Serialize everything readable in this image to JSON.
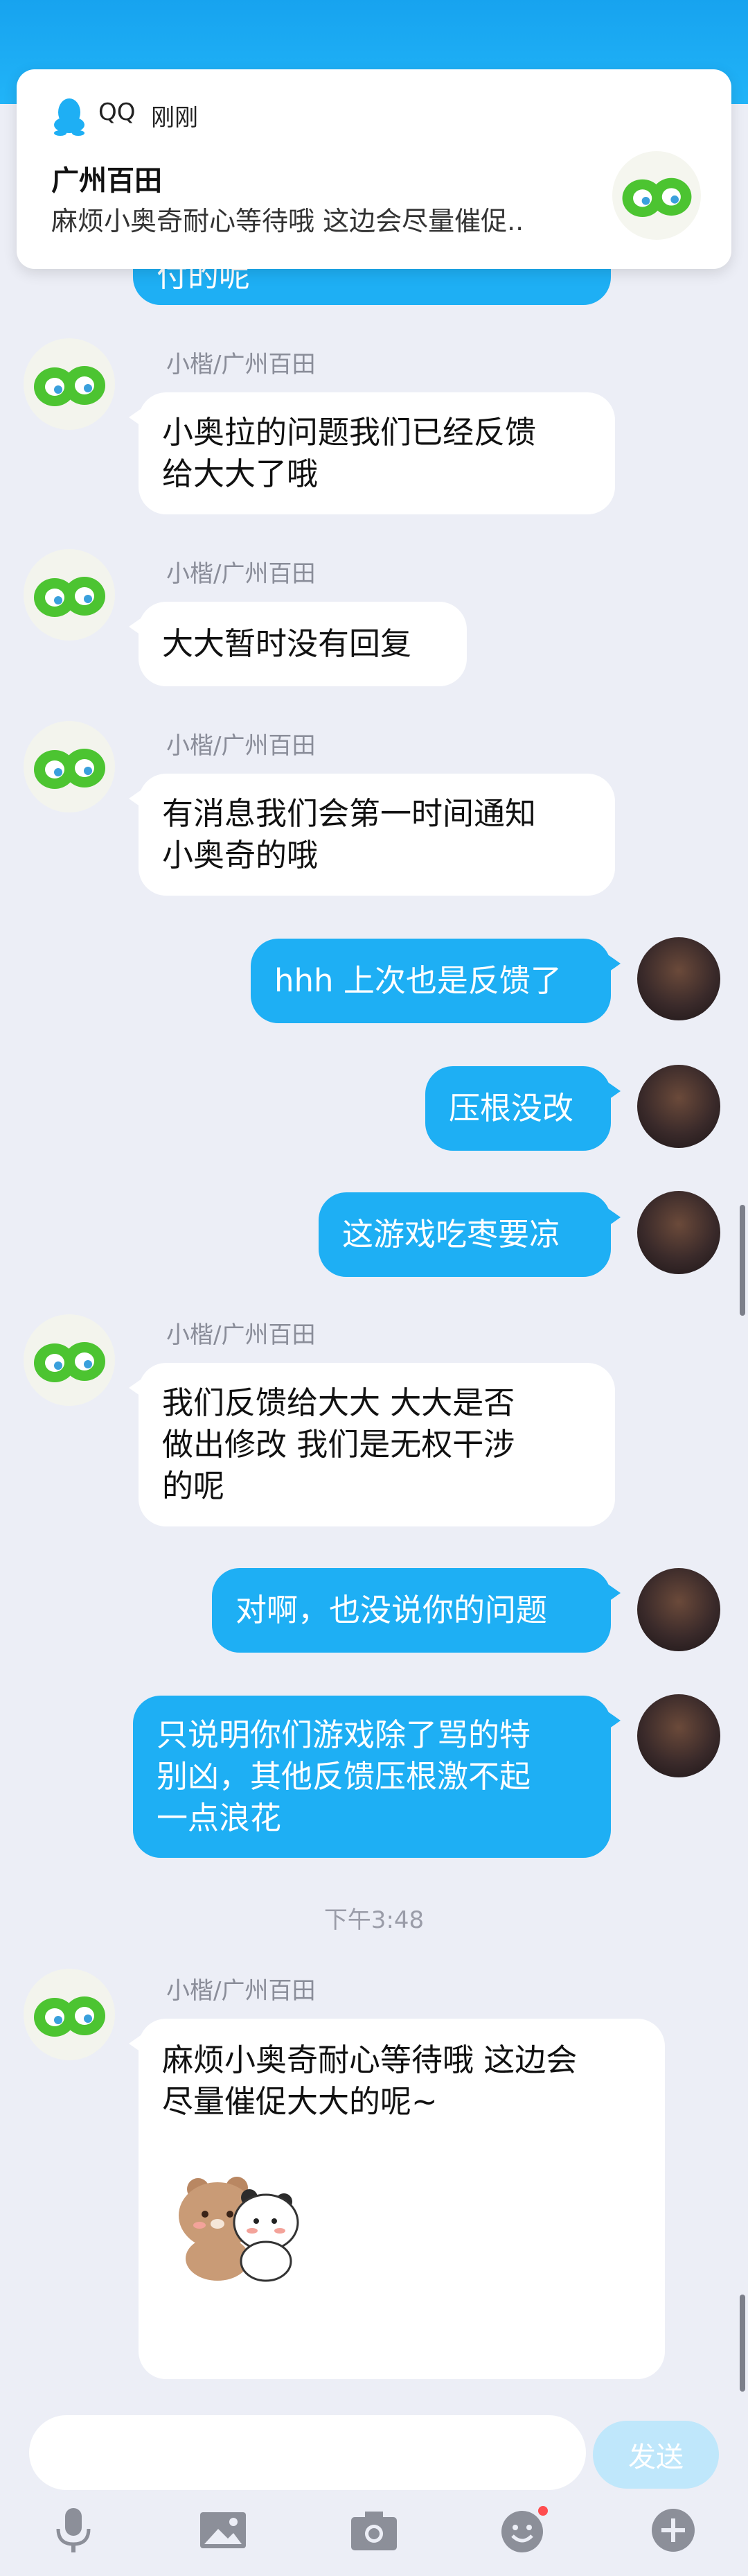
{
  "colors": {
    "header_blue": "#1eaff4",
    "bubble_out": "#1eaff4",
    "bubble_in": "#ffffff",
    "background": "#eceef6",
    "send_button": "#bfe7fb",
    "notification_dot": "#ff4d4f"
  },
  "notification": {
    "app_name": "QQ",
    "time": "刚刚",
    "title": "广州百田",
    "body": "麻烦小奥奇耐心等待哦  这边会尽量催促..",
    "app_icon": "qq-penguin-icon",
    "avatar_icon": "game-logo-avatar"
  },
  "chat": {
    "partial_bubble_text": "付的呢",
    "messages": [
      {
        "direction": "in",
        "sender": "小楷/广州百田",
        "lines": [
          "小奥拉的问题我们已经反馈",
          "给大大了哦"
        ]
      },
      {
        "direction": "in",
        "sender": "小楷/广州百田",
        "lines": [
          "大大暂时没有回复"
        ]
      },
      {
        "direction": "in",
        "sender": "小楷/广州百田",
        "lines": [
          "有消息我们会第一时间通知",
          "小奥奇的哦"
        ]
      },
      {
        "direction": "out",
        "lines": [
          "hhh 上次也是反馈了"
        ]
      },
      {
        "direction": "out",
        "lines": [
          "压根没改"
        ]
      },
      {
        "direction": "out",
        "lines": [
          "这游戏吃枣要凉"
        ]
      },
      {
        "direction": "in",
        "sender": "小楷/广州百田",
        "lines": [
          "我们反馈给大大  大大是否",
          "做出修改 我们是无权干涉",
          "的呢"
        ]
      },
      {
        "direction": "out",
        "lines": [
          "对啊，也没说你的问题"
        ]
      },
      {
        "direction": "out",
        "lines": [
          "只说明你们游戏除了骂的特",
          "别凶，其他反馈压根激不起",
          "一点浪花"
        ]
      },
      {
        "direction": "in",
        "sender": "小楷/广州百田",
        "lines": [
          "麻烦小奥奇耐心等待哦  这边会",
          "尽量催促大大的呢~"
        ],
        "sticker": "bear-and-panda-hug-sticker"
      }
    ],
    "timestamp": "下午3:48"
  },
  "input": {
    "placeholder": "",
    "value": "",
    "send_label": "发送"
  },
  "toolbar": [
    {
      "icon": "microphone-icon"
    },
    {
      "icon": "image-icon"
    },
    {
      "icon": "camera-icon"
    },
    {
      "icon": "emoji-icon",
      "badge": true
    },
    {
      "icon": "plus-icon"
    }
  ]
}
